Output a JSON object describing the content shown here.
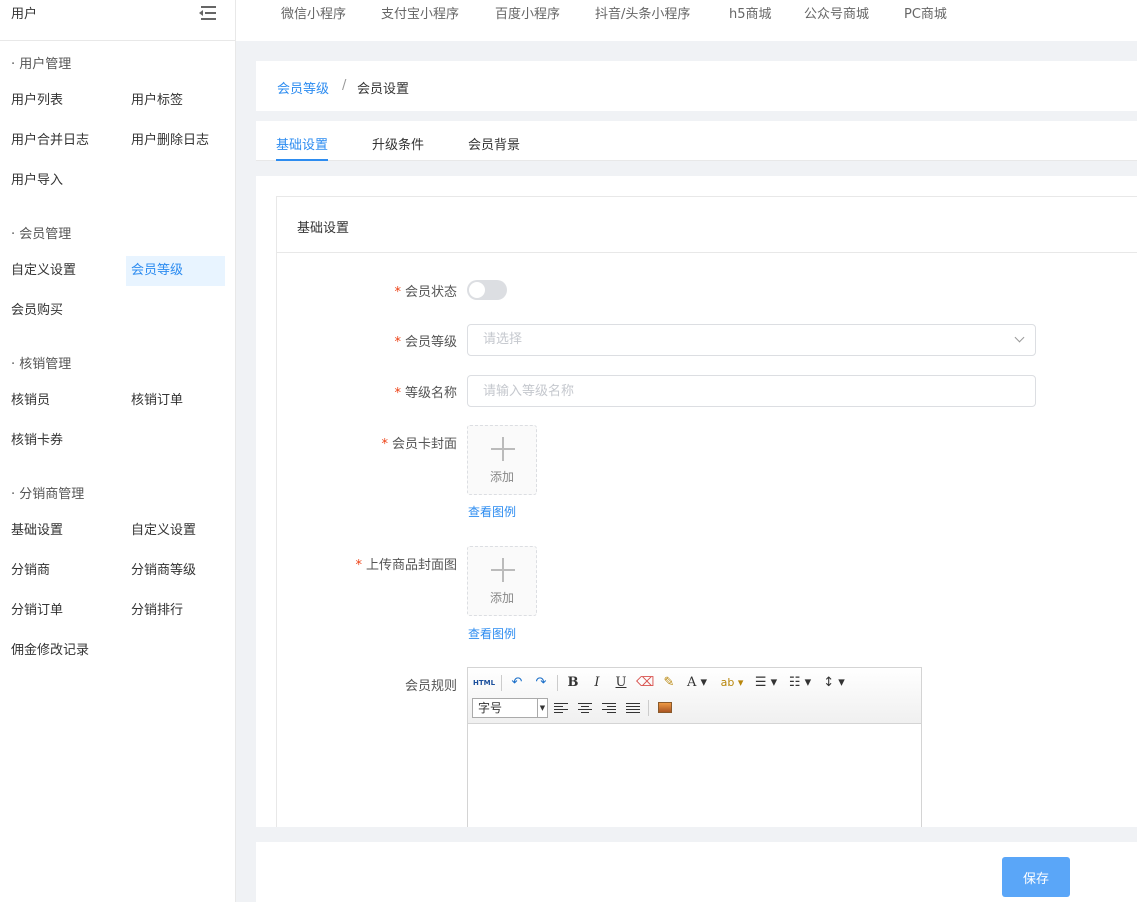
{
  "sidebar": {
    "title": "用户",
    "groups": [
      {
        "title": "· 用户管理",
        "items": [
          "用户列表",
          "用户标签",
          "用户合并日志",
          "用户删除日志",
          "用户导入"
        ]
      },
      {
        "title": "· 会员管理",
        "items": [
          "自定义设置",
          "会员等级",
          "会员购买"
        ]
      },
      {
        "title": "· 核销管理",
        "items": [
          "核销员",
          "核销订单",
          "核销卡券"
        ]
      },
      {
        "title": "· 分销商管理",
        "items": [
          "基础设置",
          "自定义设置",
          "分销商",
          "分销商等级",
          "分销订单",
          "分销排行",
          "佣金修改记录"
        ]
      }
    ],
    "active_item": "会员等级"
  },
  "top_tabs": [
    "微信小程序",
    "支付宝小程序",
    "百度小程序",
    "抖音/头条小程序",
    "h5商城",
    "公众号商城",
    "PC商城"
  ],
  "breadcrumb": {
    "parent": "会员等级",
    "separator": "/",
    "current": "会员设置"
  },
  "tabs": [
    "基础设置",
    "升级条件",
    "会员背景"
  ],
  "active_tab": "基础设置",
  "card": {
    "title": "基础设置"
  },
  "form": {
    "status_label": "会员状态",
    "status_on": false,
    "level_label": "会员等级",
    "level_placeholder": "请选择",
    "name_label": "等级名称",
    "name_placeholder": "请输入等级名称",
    "cover_label": "会员卡封面",
    "cover_add": "添加",
    "cover_view": "查看图例",
    "goods_cover_label": "上传商品封面图",
    "goods_cover_add": "添加",
    "goods_cover_view": "查看图例",
    "rules_label": "会员规则",
    "required_mark": "*"
  },
  "editor": {
    "html_btn": "HTML",
    "fontsize_label": "字号"
  },
  "footer": {
    "save_label": "保存"
  },
  "colors": {
    "accent": "#2d8cf0",
    "required": "#ed4014",
    "save_button": "#5aa6f8"
  }
}
